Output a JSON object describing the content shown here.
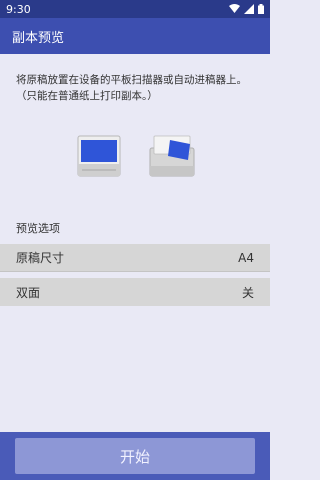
{
  "status_bar": {
    "time": "9:30",
    "icons": [
      "wifi-icon",
      "signal-icon",
      "battery-icon"
    ]
  },
  "app_bar": {
    "title": "副本预览"
  },
  "instructions": {
    "line1": "将原稿放置在设备的平板扫描器或自动进稿器上。",
    "line2": "（只能在普通纸上打印副本。）"
  },
  "illustrations": [
    "flatbed-scanner-icon",
    "document-feeder-icon"
  ],
  "preview_options": {
    "title": "预览选项",
    "items": [
      {
        "label": "原稿尺寸",
        "value": "A4"
      },
      {
        "label": "双面",
        "value": "关"
      }
    ]
  },
  "start_button": {
    "label": "开始"
  },
  "colors": {
    "status_bar": "#2a3a8a",
    "app_bar": "#3d4fb0",
    "background": "#e9e9f5",
    "option_row": "#d6d6d6",
    "bottom_bar": "#4a5bb8",
    "start_button": "#8d97d6",
    "screen_blue": "#2f55d8"
  }
}
